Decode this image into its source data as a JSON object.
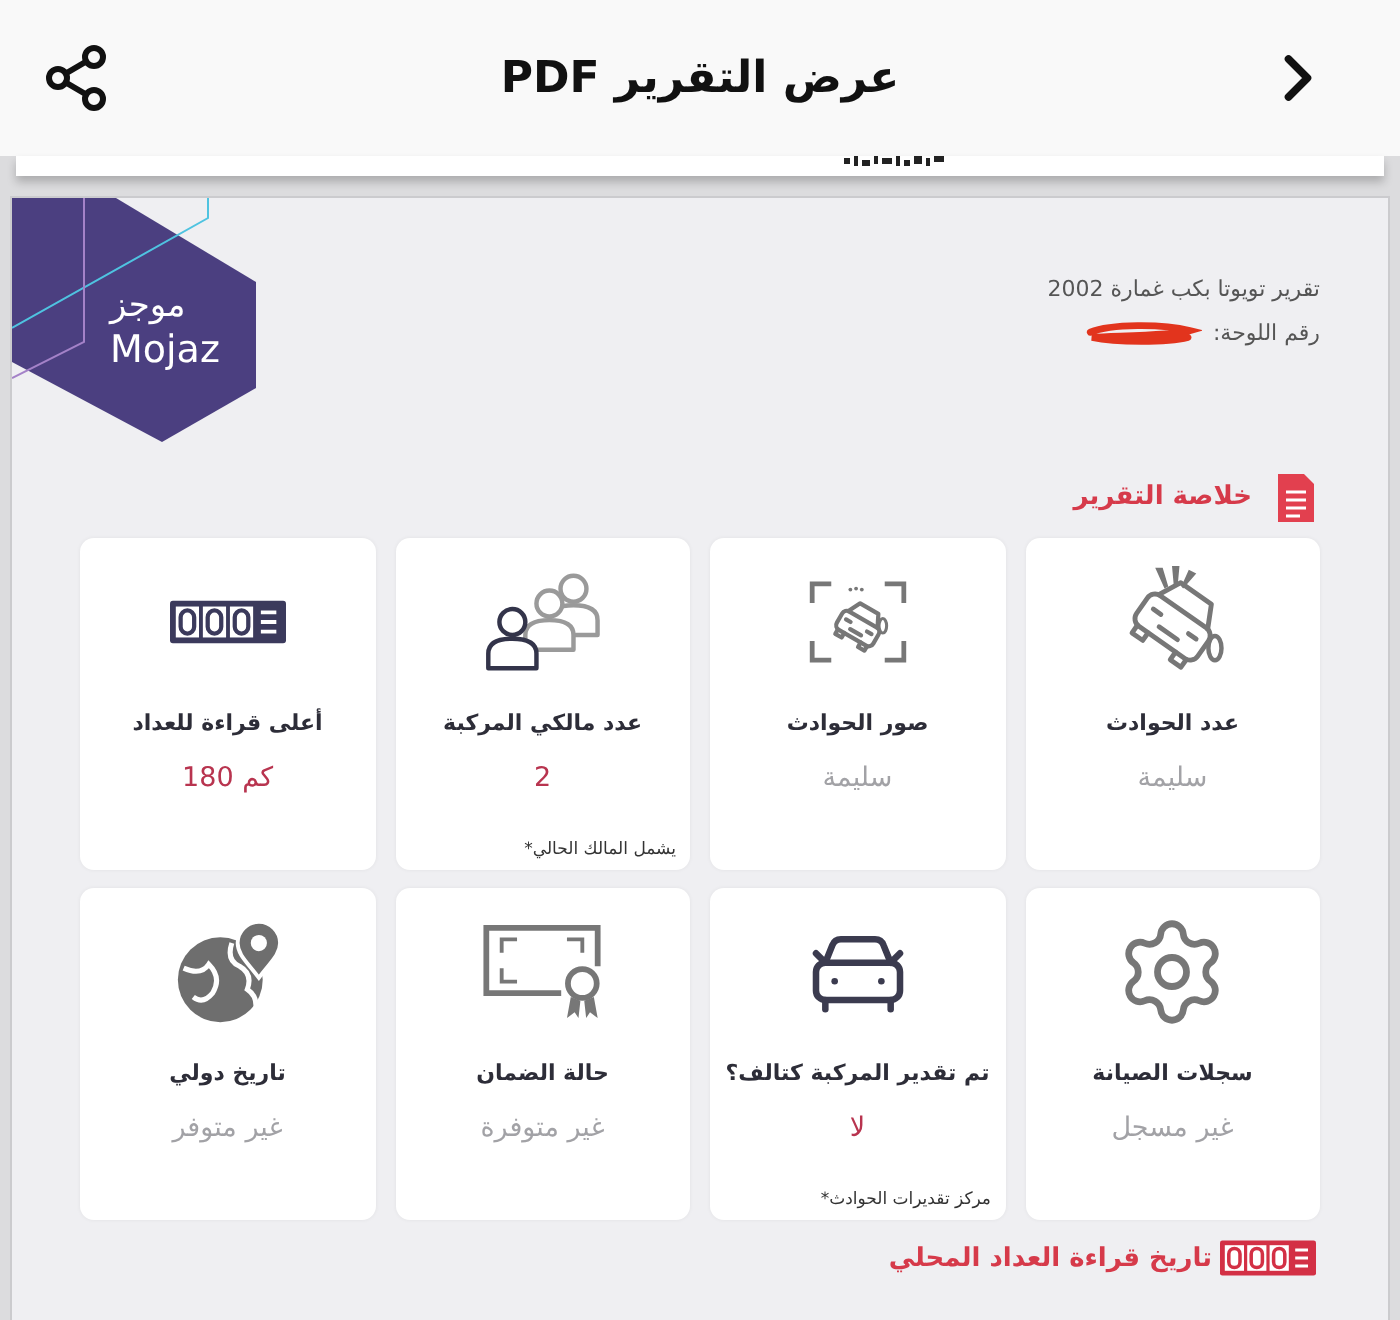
{
  "header": {
    "title": "عرض التقرير PDF"
  },
  "report": {
    "logo": {
      "arabic": "موجز",
      "latin": "Mojaz"
    },
    "vehicle_title": "تقرير تويوتا بكب غمارة 2002",
    "plate_label": "رقم اللوحة:"
  },
  "summary": {
    "title": "خلاصة التقرير",
    "cards": [
      {
        "title": "عدد الحوادث",
        "value": "سليمة",
        "highlighted": false
      },
      {
        "title": "صور الحوادث",
        "value": "سليمة",
        "highlighted": false
      },
      {
        "title": "عدد مالكي المركبة",
        "value": "2",
        "highlighted": true,
        "note": "*يشمل المالك الحالي"
      },
      {
        "title": "أعلى قراءة للعداد",
        "value": "180 كم",
        "highlighted": true
      },
      {
        "title": "سجلات الصيانة",
        "value": "غير مسجل",
        "highlighted": false
      },
      {
        "title": "تم تقدير المركبة كتالف؟",
        "value": "لا",
        "highlighted": true,
        "note": "*مركز تقديرات الحوادث"
      },
      {
        "title": "حالة الضمان",
        "value": "غير متوفرة",
        "highlighted": false
      },
      {
        "title": "تاريخ دولي",
        "value": "غير متوفر",
        "highlighted": false
      }
    ]
  },
  "odometer_history": {
    "title": "تاريخ قراءة العداد المحلي"
  }
}
